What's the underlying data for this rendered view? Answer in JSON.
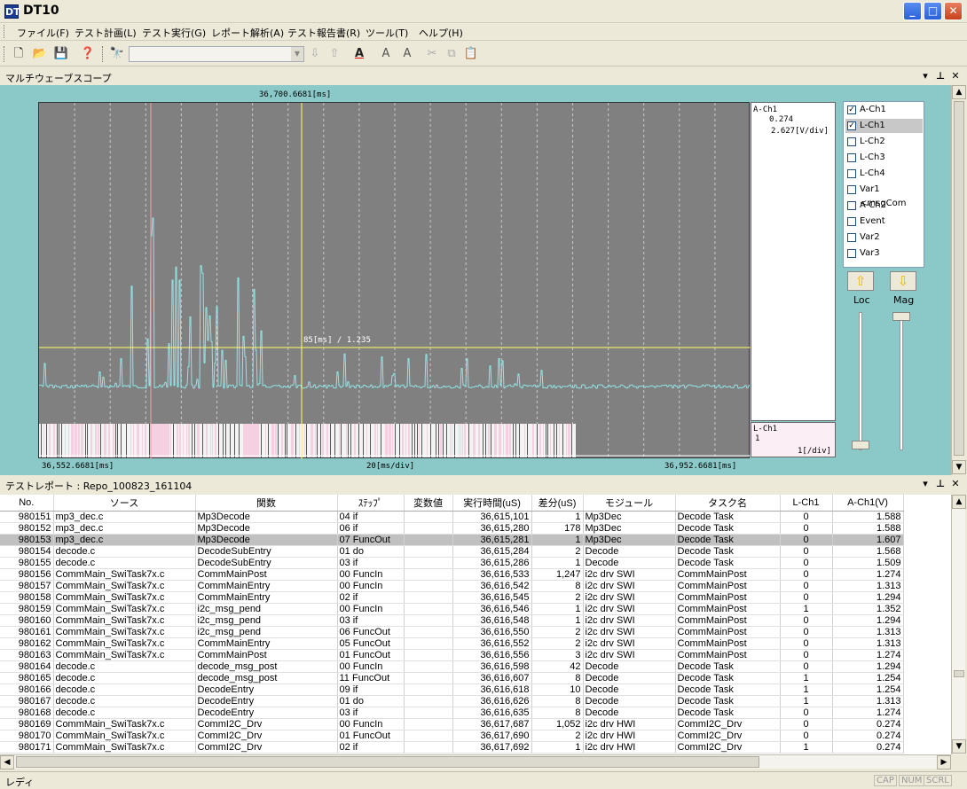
{
  "app": {
    "title": "DT10",
    "icon_label": "DT"
  },
  "menu": [
    "ファイル(F)",
    "テスト計画(L)",
    "テスト実行(G)",
    "レポート解析(A)",
    "テスト報告書(R)",
    "ツール(T)",
    "ヘルプ(H)"
  ],
  "toolbar": {
    "combo_value": ""
  },
  "scope_panel": {
    "title": "マルチウェーブスコープ"
  },
  "plot": {
    "cursor_time": "36,700.6681[ms]",
    "measure": "85[ms] /   1.235",
    "x_start": "36,552.6681[ms]",
    "x_div": "20[ms/div]",
    "x_end": "36,952.6681[ms]"
  },
  "side_a": {
    "name": "A-Ch1",
    "value": "0.274",
    "scale": "2.627[V/div]"
  },
  "side_l": {
    "name": "L-Ch1",
    "value": "1",
    "scale": "1[/div]"
  },
  "channels": [
    {
      "label": "A-Ch1",
      "checked": true
    },
    {
      "label": "L-Ch1",
      "checked": true
    },
    {
      "label": "L-Ch2",
      "checked": false
    },
    {
      "label": "L-Ch3",
      "checked": false
    },
    {
      "label": "L-Ch4",
      "checked": false
    },
    {
      "label": "Var1 <msgCom",
      "checked": false
    },
    {
      "label": "A-Ch2",
      "checked": false
    },
    {
      "label": "Event",
      "checked": false
    },
    {
      "label": "Var2",
      "checked": false
    },
    {
      "label": "Var3",
      "checked": false
    }
  ],
  "slider_labels": {
    "loc": "Loc",
    "mag": "Mag"
  },
  "report_panel": {
    "title": "テストレポート : Repo_100823_161104"
  },
  "table": {
    "columns": [
      "No.",
      "ソース",
      "関数",
      "ｽﾃｯﾌﾟ",
      "変数値",
      "実行時間(uS)",
      "差分(uS)",
      "モジュール",
      "タスク名",
      "L-Ch1",
      "A-Ch1(V)"
    ],
    "rows": [
      [
        "980151",
        "mp3_dec.c",
        "Mp3Decode",
        "04 if",
        "",
        "36,615,101",
        "1",
        "Mp3Dec",
        "Decode Task",
        "0",
        "1.588"
      ],
      [
        "980152",
        "mp3_dec.c",
        "Mp3Decode",
        "06 if",
        "",
        "36,615,280",
        "178",
        "Mp3Dec",
        "Decode Task",
        "0",
        "1.588"
      ],
      [
        "980153",
        "mp3_dec.c",
        "Mp3Decode",
        "07 FuncOut",
        "",
        "36,615,281",
        "1",
        "Mp3Dec",
        "Decode Task",
        "0",
        "1.607"
      ],
      [
        "980154",
        "decode.c",
        "DecodeSubEntry",
        "01 do",
        "",
        "36,615,284",
        "2",
        "Decode",
        "Decode Task",
        "0",
        "1.568"
      ],
      [
        "980155",
        "decode.c",
        "DecodeSubEntry",
        "03 if",
        "",
        "36,615,286",
        "1",
        "Decode",
        "Decode Task",
        "0",
        "1.509"
      ],
      [
        "980156",
        "CommMain_SwiTask7x.c",
        "CommMainPost",
        "00 FuncIn",
        "",
        "36,616,533",
        "1,247",
        "i2c drv SWI",
        "CommMainPost",
        "0",
        "1.274"
      ],
      [
        "980157",
        "CommMain_SwiTask7x.c",
        "CommMainEntry",
        "00 FuncIn",
        "",
        "36,616,542",
        "8",
        "i2c drv SWI",
        "CommMainPost",
        "0",
        "1.313"
      ],
      [
        "980158",
        "CommMain_SwiTask7x.c",
        "CommMainEntry",
        "02 if",
        "",
        "36,616,545",
        "2",
        "i2c drv SWI",
        "CommMainPost",
        "0",
        "1.294"
      ],
      [
        "980159",
        "CommMain_SwiTask7x.c",
        "i2c_msg_pend",
        "00 FuncIn",
        "",
        "36,616,546",
        "1",
        "i2c drv SWI",
        "CommMainPost",
        "1",
        "1.352"
      ],
      [
        "980160",
        "CommMain_SwiTask7x.c",
        "i2c_msg_pend",
        "03 if",
        "",
        "36,616,548",
        "1",
        "i2c drv SWI",
        "CommMainPost",
        "0",
        "1.294"
      ],
      [
        "980161",
        "CommMain_SwiTask7x.c",
        "i2c_msg_pend",
        "06 FuncOut",
        "",
        "36,616,550",
        "2",
        "i2c drv SWI",
        "CommMainPost",
        "0",
        "1.313"
      ],
      [
        "980162",
        "CommMain_SwiTask7x.c",
        "CommMainEntry",
        "05 FuncOut",
        "",
        "36,616,552",
        "2",
        "i2c drv SWI",
        "CommMainPost",
        "0",
        "1.313"
      ],
      [
        "980163",
        "CommMain_SwiTask7x.c",
        "CommMainPost",
        "01 FuncOut",
        "",
        "36,616,556",
        "3",
        "i2c drv SWI",
        "CommMainPost",
        "0",
        "1.274"
      ],
      [
        "980164",
        "decode.c",
        "decode_msg_post",
        "00 FuncIn",
        "",
        "36,616,598",
        "42",
        "Decode",
        "Decode Task",
        "0",
        "1.294"
      ],
      [
        "980165",
        "decode.c",
        "decode_msg_post",
        "11 FuncOut",
        "",
        "36,616,607",
        "8",
        "Decode",
        "Decode Task",
        "1",
        "1.254"
      ],
      [
        "980166",
        "decode.c",
        "DecodeEntry",
        "09 if",
        "",
        "36,616,618",
        "10",
        "Decode",
        "Decode Task",
        "1",
        "1.254"
      ],
      [
        "980167",
        "decode.c",
        "DecodeEntry",
        "01 do",
        "",
        "36,616,626",
        "8",
        "Decode",
        "Decode Task",
        "1",
        "1.313"
      ],
      [
        "980168",
        "decode.c",
        "DecodeEntry",
        "03 if",
        "",
        "36,616,635",
        "8",
        "Decode",
        "Decode Task",
        "0",
        "1.274"
      ],
      [
        "980169",
        "CommMain_SwiTask7x.c",
        "CommI2C_Drv",
        "00 FuncIn",
        "",
        "36,617,687",
        "1,052",
        "i2c drv HWI",
        "CommI2C_Drv",
        "0",
        "0.274"
      ],
      [
        "980170",
        "CommMain_SwiTask7x.c",
        "CommI2C_Drv",
        "01 FuncOut",
        "",
        "36,617,690",
        "2",
        "i2c drv HWI",
        "CommI2C_Drv",
        "0",
        "0.274"
      ],
      [
        "980171",
        "CommMain_SwiTask7x.c",
        "CommI2C_Drv",
        "02 if",
        "",
        "36,617,692",
        "1",
        "i2c drv HWI",
        "CommI2C_Drv",
        "1",
        "0.274"
      ]
    ],
    "selected_row": 2
  },
  "status": {
    "text": "レディ",
    "indicators": [
      "CAP",
      "NUM",
      "SCRL"
    ]
  },
  "colors": {
    "scope_bg": "#8ac9c8",
    "plot_bg": "#808080",
    "wave": "#8fe6e6",
    "cursor": "#ffff66",
    "logic": "#f4d0e0"
  }
}
